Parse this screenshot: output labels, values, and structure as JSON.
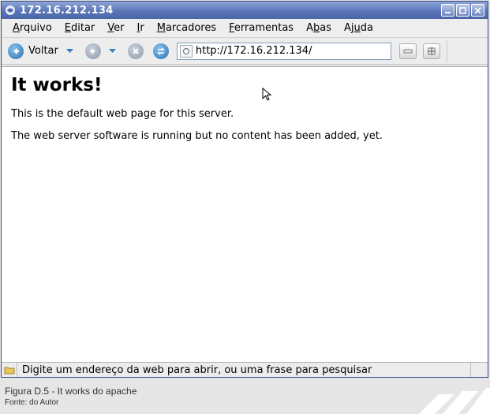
{
  "window": {
    "title": "172.16.212.134"
  },
  "menu": {
    "items": [
      {
        "label": "Arquivo",
        "accel": "A",
        "rest": "rquivo"
      },
      {
        "label": "Editar",
        "accel": "E",
        "rest": "ditar"
      },
      {
        "label": "Ver",
        "accel": "V",
        "rest": "er"
      },
      {
        "label": "Ir",
        "accel": "I",
        "rest": "r"
      },
      {
        "label": "Marcadores",
        "accel": "M",
        "rest": "arcadores"
      },
      {
        "label": "Ferramentas",
        "accel": "F",
        "rest": "erramentas"
      },
      {
        "label": "Abas",
        "pre": "A",
        "accel": "b",
        "rest": "as"
      },
      {
        "label": "Ajuda",
        "pre": "Aj",
        "accel": "u",
        "rest": "da"
      }
    ]
  },
  "toolbar": {
    "back_label": "Voltar",
    "url": "http://172.16.212.134/"
  },
  "page": {
    "heading": "It works!",
    "paragraph1": "This is the default web page for this server.",
    "paragraph2": "The web server software is running but no content has been added, yet."
  },
  "status": {
    "text": "Digite um endereço da web para abrir, ou uma frase para pesquisar"
  },
  "caption": {
    "title": "Figura D.5 - It works do apache",
    "source": "Fonte: do Autor"
  },
  "colors": {
    "titlebar": "#5a76b8",
    "nav_blue": "#2a6fb2",
    "nav_grey": "#8e9aab"
  },
  "icons": {
    "title": "browser-globe-icon",
    "back": "arrow-left-icon",
    "forward": "arrow-right-icon",
    "stop": "stop-x-icon",
    "reload": "reload-icon",
    "favicon": "page-icon",
    "status": "folder-lock-icon"
  }
}
